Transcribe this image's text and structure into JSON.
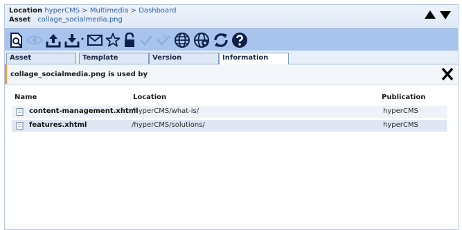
{
  "header": {
    "location_label": "Location",
    "location_path": "hyperCMS > Multimedia > Dashboard",
    "asset_label": "Asset",
    "asset_name": "collage_socialmedia.png"
  },
  "nav_icons": [
    "arrow-up-icon",
    "arrow-down-icon"
  ],
  "toolbar": {
    "icons": [
      "preview-icon",
      "view-icon",
      "upload-icon",
      "download-icon",
      "send-mail-icon",
      "favorite-star-icon",
      "lock-icon",
      "publish-check-icon",
      "unpublish-check-icon",
      "globe-icon",
      "globe-gear-icon",
      "refresh-icon",
      "help-icon"
    ]
  },
  "tabs": [
    {
      "label": "Asset",
      "active": false
    },
    {
      "label": "Template",
      "active": false
    },
    {
      "label": "Version",
      "active": false
    },
    {
      "label": "Information",
      "active": true
    }
  ],
  "usage": {
    "title": "collage_socialmedia.png is used by",
    "columns": {
      "name": "Name",
      "location": "Location",
      "publication": "Publication"
    },
    "rows": [
      {
        "name": "content-management.xhtml",
        "location": "/hyperCMS/what-is/",
        "publication": "hyperCMS"
      },
      {
        "name": "features.xhtml",
        "location": "/hyperCMS/solutions/",
        "publication": "hyperCMS"
      }
    ]
  },
  "colors": {
    "toolbar_bg": "#a9c4ec",
    "accent_orange": "#f39a34",
    "link_blue": "#2e5fa8",
    "icon_dark": "#0d1f4a",
    "icon_disabled": "#8fb0e0"
  }
}
